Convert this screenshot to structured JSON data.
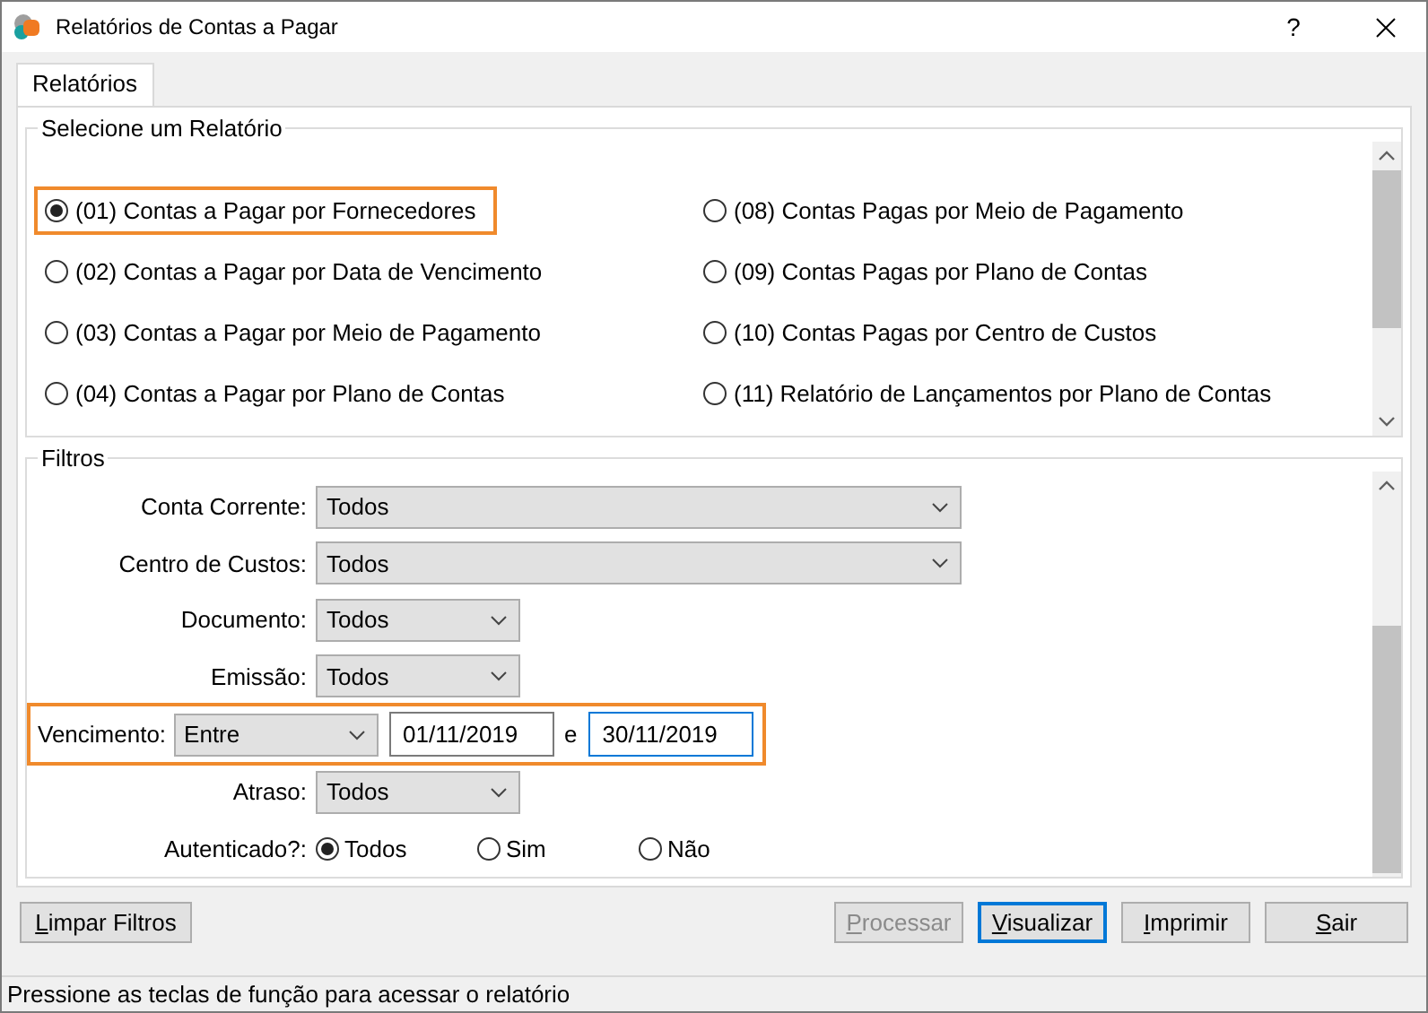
{
  "window": {
    "title": "Relatórios de Contas a Pagar",
    "help": "?"
  },
  "tabs": [
    {
      "label": "Relatórios",
      "selected": true
    }
  ],
  "report_group": {
    "title": "Selecione um Relatório",
    "options": [
      {
        "label": "(01) Contas a Pagar por Fornecedores",
        "selected": true,
        "highlighted": true
      },
      {
        "label": "(02) Contas a Pagar por Data de Vencimento",
        "selected": false,
        "highlighted": false
      },
      {
        "label": "(03) Contas a Pagar por Meio de Pagamento",
        "selected": false,
        "highlighted": false
      },
      {
        "label": "(04) Contas a Pagar por Plano de Contas",
        "selected": false,
        "highlighted": false
      },
      {
        "label": "(08) Contas Pagas por Meio de Pagamento",
        "selected": false,
        "highlighted": false
      },
      {
        "label": "(09) Contas Pagas por Plano de Contas",
        "selected": false,
        "highlighted": false
      },
      {
        "label": "(10) Contas Pagas por Centro de Custos",
        "selected": false,
        "highlighted": false
      },
      {
        "label": "(11) Relatório de Lançamentos por Plano de Contas",
        "selected": false,
        "highlighted": false
      }
    ]
  },
  "filters": {
    "title": "Filtros",
    "rows": [
      {
        "kind": "select",
        "label": "Conta Corrente:",
        "value": "Todos",
        "wide": true
      },
      {
        "kind": "select",
        "label": "Centro de Custos:",
        "value": "Todos",
        "wide": true
      },
      {
        "kind": "select",
        "label": "Documento:",
        "value": "Todos",
        "wide": false
      },
      {
        "kind": "select",
        "label": "Emissão:",
        "value": "Todos",
        "wide": false
      },
      {
        "kind": "range",
        "label": "Vencimento:",
        "value": "Entre",
        "from": "01/11/2019",
        "joiner": "e",
        "to": "30/11/2019",
        "highlighted": true
      },
      {
        "kind": "select",
        "label": "Atraso:",
        "value": "Todos",
        "wide": false
      },
      {
        "kind": "radio",
        "label": "Autenticado?:",
        "options": [
          {
            "label": "Todos",
            "selected": true
          },
          {
            "label": "Sim",
            "selected": false
          },
          {
            "label": "Não",
            "selected": false
          }
        ]
      }
    ]
  },
  "left_buttons": [
    {
      "label": "Limpar Filtros",
      "disabled": false,
      "default": false
    }
  ],
  "right_buttons": [
    {
      "label": "Processar",
      "disabled": true,
      "default": false
    },
    {
      "label": "Visualizar",
      "disabled": false,
      "default": true
    },
    {
      "label": "Imprimir",
      "disabled": false,
      "default": false
    },
    {
      "label": "Sair",
      "disabled": false,
      "default": false
    }
  ],
  "status_bar": "Pressione as teclas de função para acessar o relatório"
}
